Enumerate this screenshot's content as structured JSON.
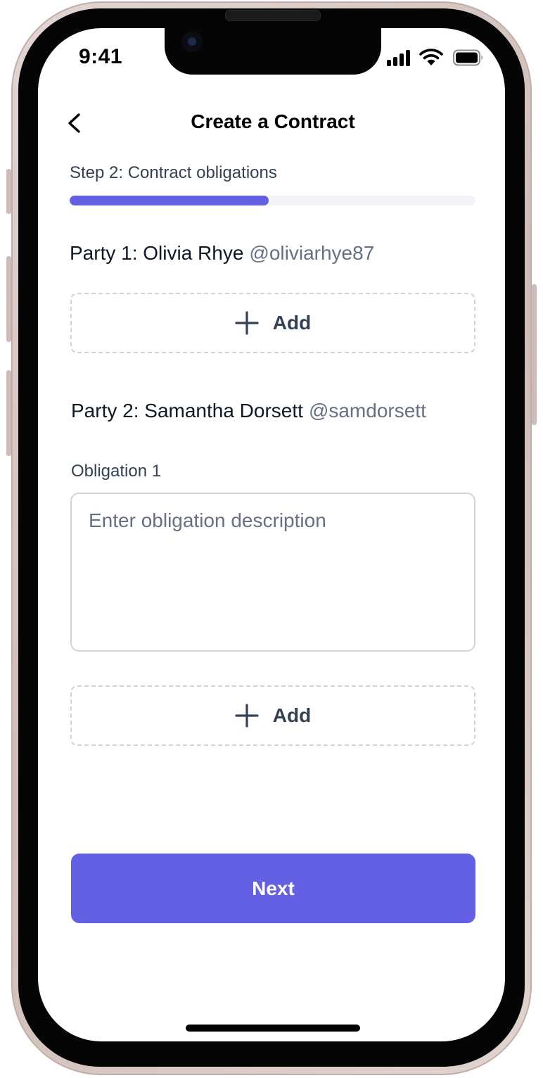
{
  "status_bar": {
    "time": "9:41",
    "icons": [
      "cellular-signal-icon",
      "wifi-icon",
      "battery-icon"
    ]
  },
  "header": {
    "title": "Create a Contract",
    "back_icon": "chevron-left-icon"
  },
  "step": {
    "label": "Step 2: Contract obligations",
    "progress": 0.49
  },
  "party1": {
    "name": "Party 1: Olivia Rhye",
    "handle": "@oliviarhye87",
    "add_label": "Add"
  },
  "party2": {
    "name": "Party 2: Samantha Dorsett",
    "handle": "@samdorsett",
    "obligation_label": "Obligation 1",
    "obligation_value": "",
    "obligation_placeholder": "Enter obligation description",
    "add_label": "Add"
  },
  "footer": {
    "next_label": "Next"
  },
  "colors": {
    "accent": "#6360e4",
    "progress_track": "#f2f4f7",
    "text_primary": "#101828",
    "text_secondary": "#667085",
    "border": "#d0d5dd"
  }
}
